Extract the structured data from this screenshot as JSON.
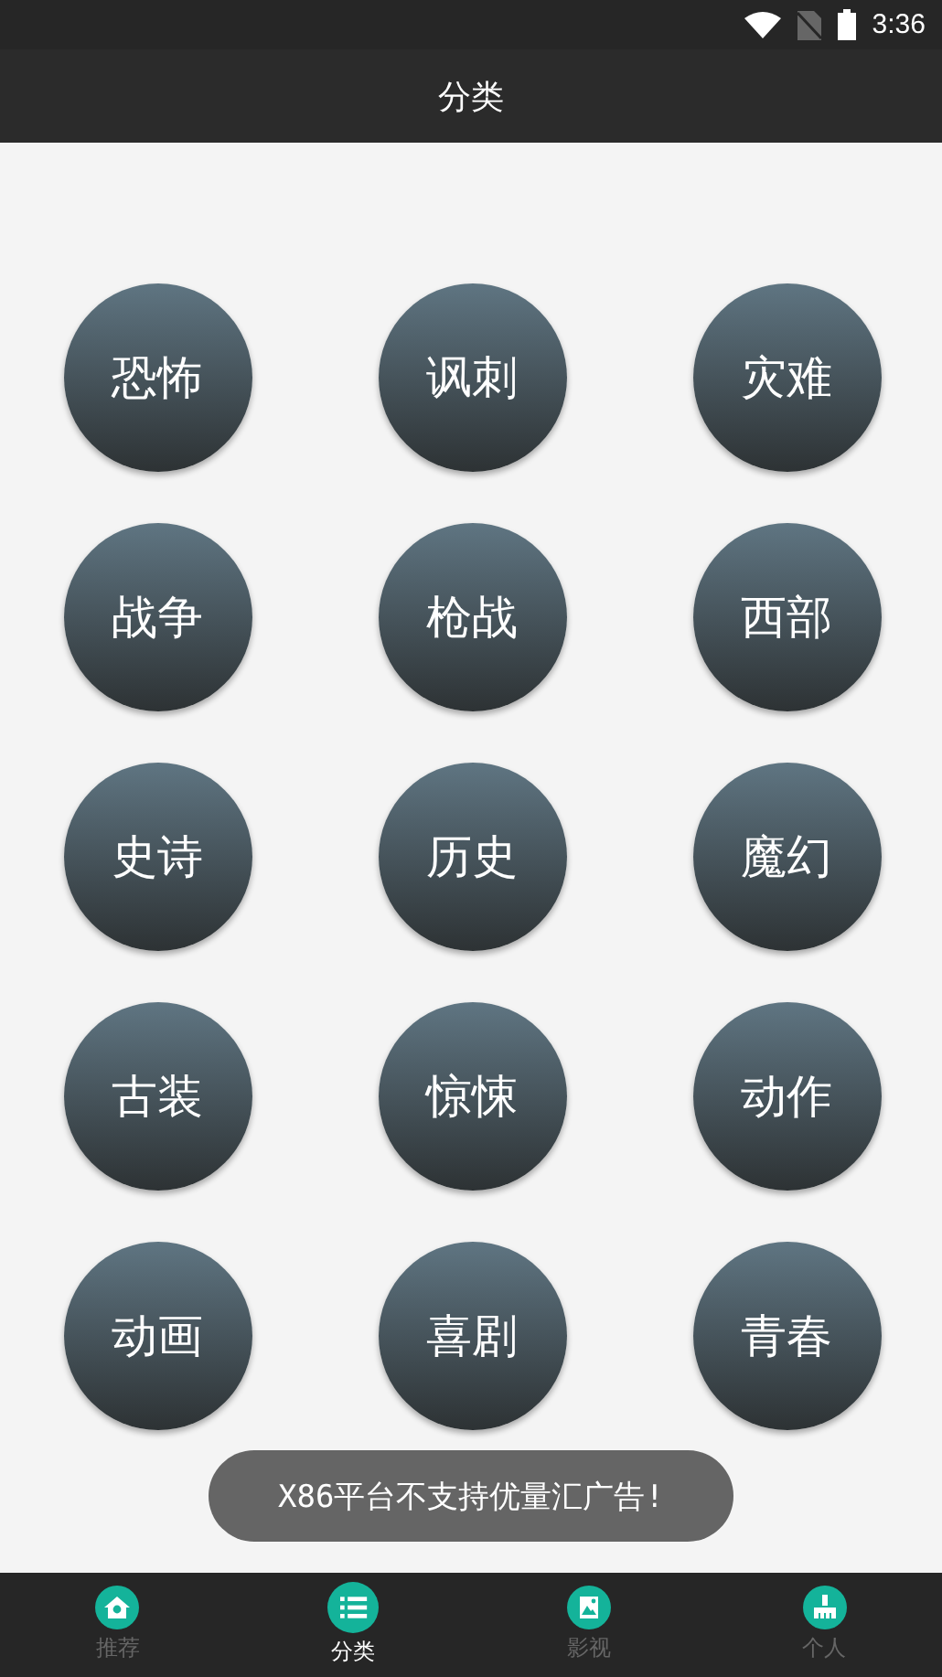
{
  "status_bar": {
    "time": "3:36"
  },
  "title": "分类",
  "categories": [
    "恐怖",
    "讽刺",
    "灾难",
    "战争",
    "枪战",
    "西部",
    "史诗",
    "历史",
    "魔幻",
    "古装",
    "惊悚",
    "动作",
    "动画",
    "喜剧",
    "青春"
  ],
  "toast": "X86平台不支持优量汇广告!",
  "tabs": [
    {
      "label": "推荐",
      "kind": "home",
      "selected": false
    },
    {
      "label": "分类",
      "kind": "list",
      "selected": true
    },
    {
      "label": "影视",
      "kind": "picture",
      "selected": false
    },
    {
      "label": "个人",
      "kind": "broom",
      "selected": false
    }
  ]
}
